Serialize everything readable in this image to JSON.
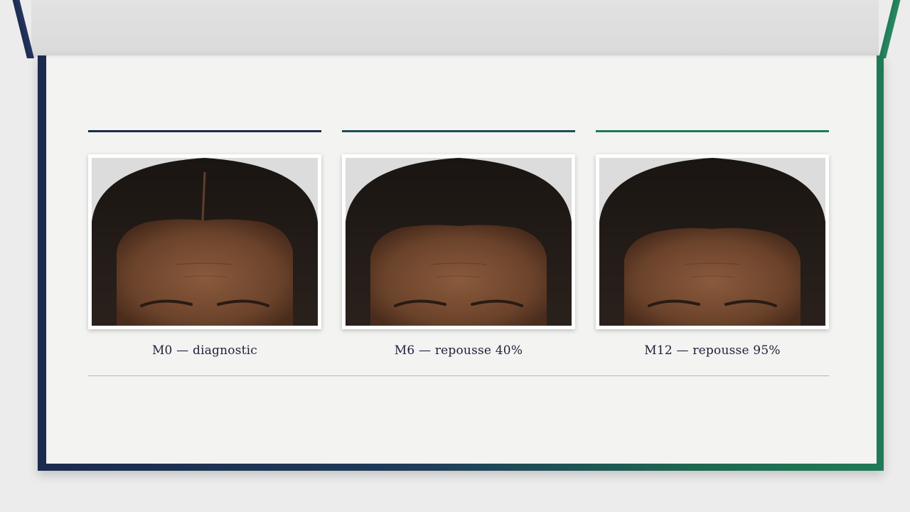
{
  "colors": {
    "navy": "#1b2a4e",
    "teal": "#1f4d5c",
    "green": "#1f7a55",
    "gold": "#c9b48a",
    "sheet": "#f3f3f2"
  },
  "panels": [
    {
      "caption": "M0 — diagnostic",
      "rule_color": "#1b2a4e",
      "image": "forehead-hairline-photo"
    },
    {
      "caption": "M6 — repousse 40%",
      "rule_color": "#1f4d5c",
      "image": "forehead-hairline-photo"
    },
    {
      "caption": "M12 — repousse 95%",
      "rule_color": "#1f7a55",
      "image": "forehead-hairline-photo"
    }
  ]
}
